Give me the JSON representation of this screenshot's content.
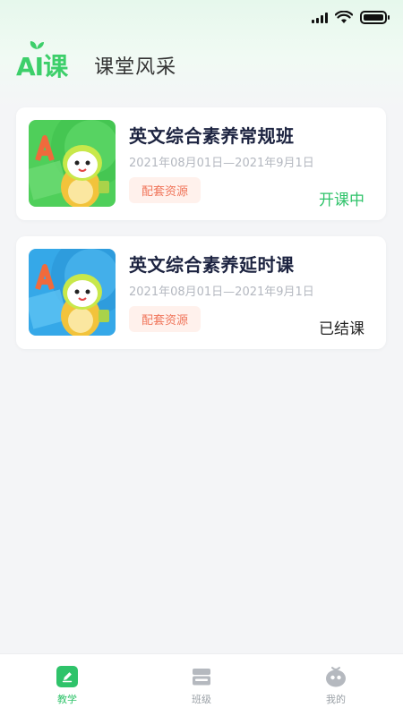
{
  "header": {
    "logo_text": "AI课",
    "title": "课堂风采"
  },
  "courses": [
    {
      "title": "英文综合素养常规班",
      "date": "2021年08月01日—2021年9月1日",
      "tag": "配套资源",
      "status": "开课中",
      "status_color": "#2fc36a",
      "thumb_color": "#4fcf5a"
    },
    {
      "title": "英文综合素养延时课",
      "date": "2021年08月01日—2021年9月1日",
      "tag": "配套资源",
      "status": "已结课",
      "status_color": "#222222",
      "thumb_color": "#35a8e8"
    }
  ],
  "tabbar": {
    "items": [
      {
        "label": "教学",
        "icon": "pencil-icon",
        "active": true
      },
      {
        "label": "班级",
        "icon": "class-icon",
        "active": false
      },
      {
        "label": "我的",
        "icon": "profile-icon",
        "active": false
      }
    ]
  },
  "colors": {
    "accent": "#2fc36a",
    "tag_bg": "#fff1ec",
    "tag_text": "#f0755a"
  }
}
